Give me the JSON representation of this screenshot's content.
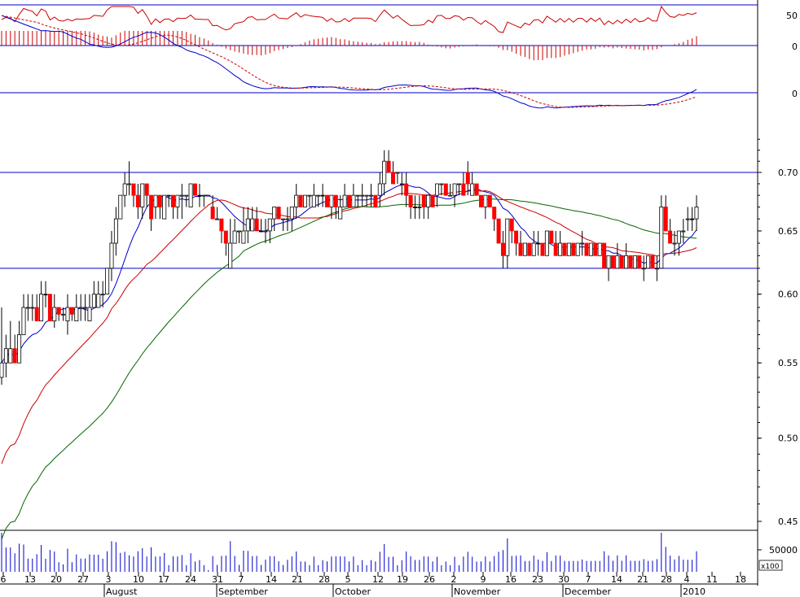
{
  "chart_data": {
    "type": "candlestick",
    "price_panel": {
      "ylim": [
        0.44,
        0.74
      ],
      "scale": "log",
      "y_ticks": [
        "0.70",
        "0.65",
        "0.60",
        "0.55",
        "0.50",
        "0.45"
      ],
      "y_tick_values": [
        0.7,
        0.65,
        0.6,
        0.55,
        0.5,
        0.45
      ],
      "reference_lines": [
        0.7,
        0.62
      ],
      "moving_average_colors": [
        "#0000cc",
        "#cc0000",
        "#006600"
      ],
      "up_color": "#ffffff",
      "down_color": "#ff0000",
      "doji_color": "#000000",
      "candles": [
        {
          "o": 0.54,
          "h": 0.59,
          "l": 0.535,
          "c": 0.55
        },
        {
          "o": 0.55,
          "h": 0.57,
          "l": 0.54,
          "c": 0.56
        },
        {
          "o": 0.55,
          "h": 0.58,
          "l": 0.55,
          "c": 0.56
        },
        {
          "o": 0.56,
          "h": 0.57,
          "l": 0.55,
          "c": 0.55
        },
        {
          "o": 0.55,
          "h": 0.58,
          "l": 0.55,
          "c": 0.57
        },
        {
          "o": 0.57,
          "h": 0.6,
          "l": 0.57,
          "c": 0.59
        },
        {
          "o": 0.59,
          "h": 0.6,
          "l": 0.58,
          "c": 0.59
        },
        {
          "o": 0.59,
          "h": 0.6,
          "l": 0.58,
          "c": 0.59
        },
        {
          "o": 0.59,
          "h": 0.6,
          "l": 0.58,
          "c": 0.58
        },
        {
          "o": 0.58,
          "h": 0.61,
          "l": 0.58,
          "c": 0.6
        },
        {
          "o": 0.6,
          "h": 0.61,
          "l": 0.59,
          "c": 0.6
        },
        {
          "o": 0.6,
          "h": 0.6,
          "l": 0.58,
          "c": 0.58
        },
        {
          "o": 0.58,
          "h": 0.6,
          "l": 0.575,
          "c": 0.59
        },
        {
          "o": 0.59,
          "h": 0.59,
          "l": 0.58,
          "c": 0.585
        },
        {
          "o": 0.585,
          "h": 0.59,
          "l": 0.58,
          "c": 0.585
        },
        {
          "o": 0.58,
          "h": 0.6,
          "l": 0.57,
          "c": 0.59
        },
        {
          "o": 0.59,
          "h": 0.59,
          "l": 0.58,
          "c": 0.585
        },
        {
          "o": 0.58,
          "h": 0.6,
          "l": 0.58,
          "c": 0.59
        },
        {
          "o": 0.59,
          "h": 0.6,
          "l": 0.58,
          "c": 0.59
        },
        {
          "o": 0.59,
          "h": 0.6,
          "l": 0.58,
          "c": 0.59
        },
        {
          "o": 0.58,
          "h": 0.6,
          "l": 0.58,
          "c": 0.59
        },
        {
          "o": 0.59,
          "h": 0.61,
          "l": 0.59,
          "c": 0.6
        },
        {
          "o": 0.59,
          "h": 0.61,
          "l": 0.59,
          "c": 0.6
        },
        {
          "o": 0.6,
          "h": 0.61,
          "l": 0.59,
          "c": 0.6
        },
        {
          "o": 0.6,
          "h": 0.62,
          "l": 0.6,
          "c": 0.62
        },
        {
          "o": 0.62,
          "h": 0.65,
          "l": 0.61,
          "c": 0.64
        },
        {
          "o": 0.64,
          "h": 0.67,
          "l": 0.63,
          "c": 0.66
        },
        {
          "o": 0.66,
          "h": 0.68,
          "l": 0.66,
          "c": 0.68
        },
        {
          "o": 0.68,
          "h": 0.7,
          "l": 0.67,
          "c": 0.69
        },
        {
          "o": 0.69,
          "h": 0.71,
          "l": 0.68,
          "c": 0.69
        },
        {
          "o": 0.69,
          "h": 0.69,
          "l": 0.67,
          "c": 0.68
        },
        {
          "o": 0.68,
          "h": 0.69,
          "l": 0.66,
          "c": 0.67
        },
        {
          "o": 0.67,
          "h": 0.69,
          "l": 0.66,
          "c": 0.69
        },
        {
          "o": 0.69,
          "h": 0.69,
          "l": 0.67,
          "c": 0.68
        },
        {
          "o": 0.68,
          "h": 0.68,
          "l": 0.65,
          "c": 0.66
        },
        {
          "o": 0.67,
          "h": 0.68,
          "l": 0.66,
          "c": 0.68
        },
        {
          "o": 0.68,
          "h": 0.68,
          "l": 0.66,
          "c": 0.67
        },
        {
          "o": 0.66,
          "h": 0.68,
          "l": 0.66,
          "c": 0.68
        },
        {
          "o": 0.68,
          "h": 0.68,
          "l": 0.67,
          "c": 0.68
        },
        {
          "o": 0.68,
          "h": 0.68,
          "l": 0.66,
          "c": 0.67
        },
        {
          "o": 0.67,
          "h": 0.68,
          "l": 0.66,
          "c": 0.68
        },
        {
          "o": 0.68,
          "h": 0.69,
          "l": 0.66,
          "c": 0.68
        },
        {
          "o": 0.68,
          "h": 0.68,
          "l": 0.67,
          "c": 0.68
        },
        {
          "o": 0.67,
          "h": 0.69,
          "l": 0.67,
          "c": 0.69
        },
        {
          "o": 0.69,
          "h": 0.69,
          "l": 0.68,
          "c": 0.68
        },
        {
          "o": 0.68,
          "h": 0.69,
          "l": 0.67,
          "c": 0.68
        },
        {
          "o": 0.68,
          "h": 0.68,
          "l": 0.67,
          "c": 0.68
        },
        {
          "o": 0.68,
          "h": 0.68,
          "l": 0.68,
          "c": 0.68
        },
        {
          "o": 0.67,
          "h": 0.68,
          "l": 0.66,
          "c": 0.66
        },
        {
          "o": 0.66,
          "h": 0.67,
          "l": 0.66,
          "c": 0.66
        },
        {
          "o": 0.66,
          "h": 0.66,
          "l": 0.64,
          "c": 0.65
        },
        {
          "o": 0.65,
          "h": 0.65,
          "l": 0.63,
          "c": 0.64
        },
        {
          "o": 0.62,
          "h": 0.66,
          "l": 0.62,
          "c": 0.64
        },
        {
          "o": 0.64,
          "h": 0.66,
          "l": 0.64,
          "c": 0.65
        },
        {
          "o": 0.65,
          "h": 0.65,
          "l": 0.64,
          "c": 0.65
        },
        {
          "o": 0.64,
          "h": 0.67,
          "l": 0.64,
          "c": 0.65
        },
        {
          "o": 0.65,
          "h": 0.67,
          "l": 0.64,
          "c": 0.66
        },
        {
          "o": 0.65,
          "h": 0.67,
          "l": 0.65,
          "c": 0.66
        },
        {
          "o": 0.66,
          "h": 0.67,
          "l": 0.65,
          "c": 0.65
        },
        {
          "o": 0.65,
          "h": 0.66,
          "l": 0.65,
          "c": 0.65
        },
        {
          "o": 0.65,
          "h": 0.66,
          "l": 0.64,
          "c": 0.65
        },
        {
          "o": 0.65,
          "h": 0.66,
          "l": 0.64,
          "c": 0.66
        },
        {
          "o": 0.66,
          "h": 0.67,
          "l": 0.65,
          "c": 0.67
        },
        {
          "o": 0.67,
          "h": 0.67,
          "l": 0.66,
          "c": 0.66
        },
        {
          "o": 0.66,
          "h": 0.66,
          "l": 0.65,
          "c": 0.66
        },
        {
          "o": 0.66,
          "h": 0.67,
          "l": 0.65,
          "c": 0.66
        },
        {
          "o": 0.66,
          "h": 0.67,
          "l": 0.65,
          "c": 0.67
        },
        {
          "o": 0.67,
          "h": 0.69,
          "l": 0.66,
          "c": 0.68
        },
        {
          "o": 0.68,
          "h": 0.68,
          "l": 0.67,
          "c": 0.67
        },
        {
          "o": 0.67,
          "h": 0.68,
          "l": 0.67,
          "c": 0.68
        },
        {
          "o": 0.68,
          "h": 0.68,
          "l": 0.67,
          "c": 0.68
        },
        {
          "o": 0.67,
          "h": 0.69,
          "l": 0.67,
          "c": 0.68
        },
        {
          "o": 0.68,
          "h": 0.68,
          "l": 0.67,
          "c": 0.68
        },
        {
          "o": 0.68,
          "h": 0.69,
          "l": 0.67,
          "c": 0.68
        },
        {
          "o": 0.68,
          "h": 0.68,
          "l": 0.67,
          "c": 0.67
        },
        {
          "o": 0.67,
          "h": 0.68,
          "l": 0.66,
          "c": 0.68
        },
        {
          "o": 0.68,
          "h": 0.68,
          "l": 0.66,
          "c": 0.67
        },
        {
          "o": 0.66,
          "h": 0.68,
          "l": 0.66,
          "c": 0.67
        },
        {
          "o": 0.67,
          "h": 0.69,
          "l": 0.67,
          "c": 0.68
        },
        {
          "o": 0.68,
          "h": 0.68,
          "l": 0.67,
          "c": 0.67
        },
        {
          "o": 0.67,
          "h": 0.69,
          "l": 0.67,
          "c": 0.68
        },
        {
          "o": 0.68,
          "h": 0.68,
          "l": 0.67,
          "c": 0.68
        },
        {
          "o": 0.68,
          "h": 0.69,
          "l": 0.67,
          "c": 0.68
        },
        {
          "o": 0.68,
          "h": 0.68,
          "l": 0.67,
          "c": 0.68
        },
        {
          "o": 0.68,
          "h": 0.69,
          "l": 0.67,
          "c": 0.68
        },
        {
          "o": 0.68,
          "h": 0.68,
          "l": 0.67,
          "c": 0.67
        },
        {
          "o": 0.68,
          "h": 0.7,
          "l": 0.67,
          "c": 0.69
        },
        {
          "o": 0.69,
          "h": 0.72,
          "l": 0.68,
          "c": 0.71
        },
        {
          "o": 0.71,
          "h": 0.72,
          "l": 0.7,
          "c": 0.7
        },
        {
          "o": 0.7,
          "h": 0.71,
          "l": 0.69,
          "c": 0.69
        },
        {
          "o": 0.7,
          "h": 0.7,
          "l": 0.69,
          "c": 0.7
        },
        {
          "o": 0.69,
          "h": 0.7,
          "l": 0.68,
          "c": 0.69
        },
        {
          "o": 0.69,
          "h": 0.7,
          "l": 0.67,
          "c": 0.68
        },
        {
          "o": 0.68,
          "h": 0.68,
          "l": 0.66,
          "c": 0.67
        },
        {
          "o": 0.67,
          "h": 0.68,
          "l": 0.66,
          "c": 0.67
        },
        {
          "o": 0.67,
          "h": 0.68,
          "l": 0.66,
          "c": 0.67
        },
        {
          "o": 0.68,
          "h": 0.68,
          "l": 0.66,
          "c": 0.67
        },
        {
          "o": 0.67,
          "h": 0.68,
          "l": 0.66,
          "c": 0.68
        },
        {
          "o": 0.68,
          "h": 0.68,
          "l": 0.67,
          "c": 0.67
        },
        {
          "o": 0.68,
          "h": 0.69,
          "l": 0.67,
          "c": 0.69
        },
        {
          "o": 0.69,
          "h": 0.69,
          "l": 0.68,
          "c": 0.69
        },
        {
          "o": 0.69,
          "h": 0.69,
          "l": 0.68,
          "c": 0.68
        },
        {
          "o": 0.68,
          "h": 0.69,
          "l": 0.68,
          "c": 0.68
        },
        {
          "o": 0.68,
          "h": 0.69,
          "l": 0.67,
          "c": 0.69
        },
        {
          "o": 0.69,
          "h": 0.69,
          "l": 0.68,
          "c": 0.69
        },
        {
          "o": 0.69,
          "h": 0.7,
          "l": 0.68,
          "c": 0.68
        },
        {
          "o": 0.7,
          "h": 0.71,
          "l": 0.68,
          "c": 0.69
        },
        {
          "o": 0.68,
          "h": 0.7,
          "l": 0.68,
          "c": 0.69
        },
        {
          "o": 0.69,
          "h": 0.69,
          "l": 0.68,
          "c": 0.68
        },
        {
          "o": 0.68,
          "h": 0.68,
          "l": 0.67,
          "c": 0.67
        },
        {
          "o": 0.67,
          "h": 0.68,
          "l": 0.66,
          "c": 0.68
        },
        {
          "o": 0.68,
          "h": 0.68,
          "l": 0.67,
          "c": 0.67
        },
        {
          "o": 0.67,
          "h": 0.67,
          "l": 0.65,
          "c": 0.66
        },
        {
          "o": 0.66,
          "h": 0.66,
          "l": 0.64,
          "c": 0.64
        },
        {
          "o": 0.64,
          "h": 0.65,
          "l": 0.62,
          "c": 0.63
        },
        {
          "o": 0.63,
          "h": 0.66,
          "l": 0.62,
          "c": 0.66
        },
        {
          "o": 0.66,
          "h": 0.66,
          "l": 0.64,
          "c": 0.65
        },
        {
          "o": 0.65,
          "h": 0.65,
          "l": 0.63,
          "c": 0.64
        },
        {
          "o": 0.64,
          "h": 0.65,
          "l": 0.63,
          "c": 0.63
        },
        {
          "o": 0.63,
          "h": 0.64,
          "l": 0.63,
          "c": 0.64
        },
        {
          "o": 0.64,
          "h": 0.64,
          "l": 0.63,
          "c": 0.63
        },
        {
          "o": 0.63,
          "h": 0.65,
          "l": 0.63,
          "c": 0.64
        },
        {
          "o": 0.64,
          "h": 0.65,
          "l": 0.63,
          "c": 0.64
        },
        {
          "o": 0.64,
          "h": 0.64,
          "l": 0.63,
          "c": 0.63
        },
        {
          "o": 0.63,
          "h": 0.65,
          "l": 0.63,
          "c": 0.65
        },
        {
          "o": 0.65,
          "h": 0.65,
          "l": 0.64,
          "c": 0.64
        },
        {
          "o": 0.64,
          "h": 0.65,
          "l": 0.63,
          "c": 0.63
        },
        {
          "o": 0.63,
          "h": 0.65,
          "l": 0.63,
          "c": 0.64
        },
        {
          "o": 0.64,
          "h": 0.64,
          "l": 0.63,
          "c": 0.63
        },
        {
          "o": 0.63,
          "h": 0.64,
          "l": 0.63,
          "c": 0.64
        },
        {
          "o": 0.64,
          "h": 0.64,
          "l": 0.63,
          "c": 0.63
        },
        {
          "o": 0.63,
          "h": 0.64,
          "l": 0.63,
          "c": 0.64
        },
        {
          "o": 0.64,
          "h": 0.65,
          "l": 0.63,
          "c": 0.64
        },
        {
          "o": 0.64,
          "h": 0.64,
          "l": 0.63,
          "c": 0.63
        },
        {
          "o": 0.63,
          "h": 0.64,
          "l": 0.63,
          "c": 0.64
        },
        {
          "o": 0.64,
          "h": 0.64,
          "l": 0.63,
          "c": 0.63
        },
        {
          "o": 0.63,
          "h": 0.64,
          "l": 0.63,
          "c": 0.64
        },
        {
          "o": 0.64,
          "h": 0.64,
          "l": 0.62,
          "c": 0.62
        },
        {
          "o": 0.62,
          "h": 0.63,
          "l": 0.61,
          "c": 0.63
        },
        {
          "o": 0.63,
          "h": 0.63,
          "l": 0.62,
          "c": 0.62
        },
        {
          "o": 0.62,
          "h": 0.64,
          "l": 0.62,
          "c": 0.63
        },
        {
          "o": 0.63,
          "h": 0.63,
          "l": 0.62,
          "c": 0.62
        },
        {
          "o": 0.62,
          "h": 0.64,
          "l": 0.62,
          "c": 0.63
        },
        {
          "o": 0.63,
          "h": 0.63,
          "l": 0.62,
          "c": 0.62
        },
        {
          "o": 0.62,
          "h": 0.63,
          "l": 0.62,
          "c": 0.63
        },
        {
          "o": 0.63,
          "h": 0.63,
          "l": 0.62,
          "c": 0.62
        },
        {
          "o": 0.62,
          "h": 0.63,
          "l": 0.61,
          "c": 0.62
        },
        {
          "o": 0.62,
          "h": 0.63,
          "l": 0.62,
          "c": 0.63
        },
        {
          "o": 0.63,
          "h": 0.63,
          "l": 0.62,
          "c": 0.62
        },
        {
          "o": 0.62,
          "h": 0.63,
          "l": 0.61,
          "c": 0.62
        },
        {
          "o": 0.62,
          "h": 0.68,
          "l": 0.62,
          "c": 0.67
        },
        {
          "o": 0.67,
          "h": 0.68,
          "l": 0.65,
          "c": 0.65
        },
        {
          "o": 0.65,
          "h": 0.66,
          "l": 0.64,
          "c": 0.64
        },
        {
          "o": 0.64,
          "h": 0.65,
          "l": 0.63,
          "c": 0.64
        },
        {
          "o": 0.64,
          "h": 0.65,
          "l": 0.63,
          "c": 0.65
        },
        {
          "o": 0.65,
          "h": 0.66,
          "l": 0.64,
          "c": 0.65
        },
        {
          "o": 0.66,
          "h": 0.67,
          "l": 0.65,
          "c": 0.66
        },
        {
          "o": 0.66,
          "h": 0.67,
          "l": 0.65,
          "c": 0.66
        },
        {
          "o": 0.66,
          "h": 0.68,
          "l": 0.65,
          "c": 0.67
        }
      ]
    },
    "indicator_panels": [
      {
        "y_tick": "50",
        "line_color": "#cc0000"
      },
      {
        "y_tick": "0",
        "bar_color": "#cc0000"
      },
      {
        "y_tick": "0",
        "line_colors": [
          "#0000cc",
          "#cc0000"
        ]
      }
    ],
    "volume_panel": {
      "y_tick": "50000",
      "multiplier_label": "x100",
      "color": "#0000cc"
    },
    "x_axis": {
      "day_ticks": [
        "6",
        "13",
        "20",
        "27",
        "3",
        "10",
        "17",
        "24",
        "31",
        "7",
        "14",
        "21",
        "28",
        "5",
        "12",
        "19",
        "26",
        "2",
        "9",
        "16",
        "23",
        "30",
        "7",
        "14",
        "21",
        "28",
        "4",
        "11",
        "18"
      ],
      "month_labels": [
        "August",
        "September",
        "October",
        "November",
        "December",
        "2010"
      ]
    }
  }
}
